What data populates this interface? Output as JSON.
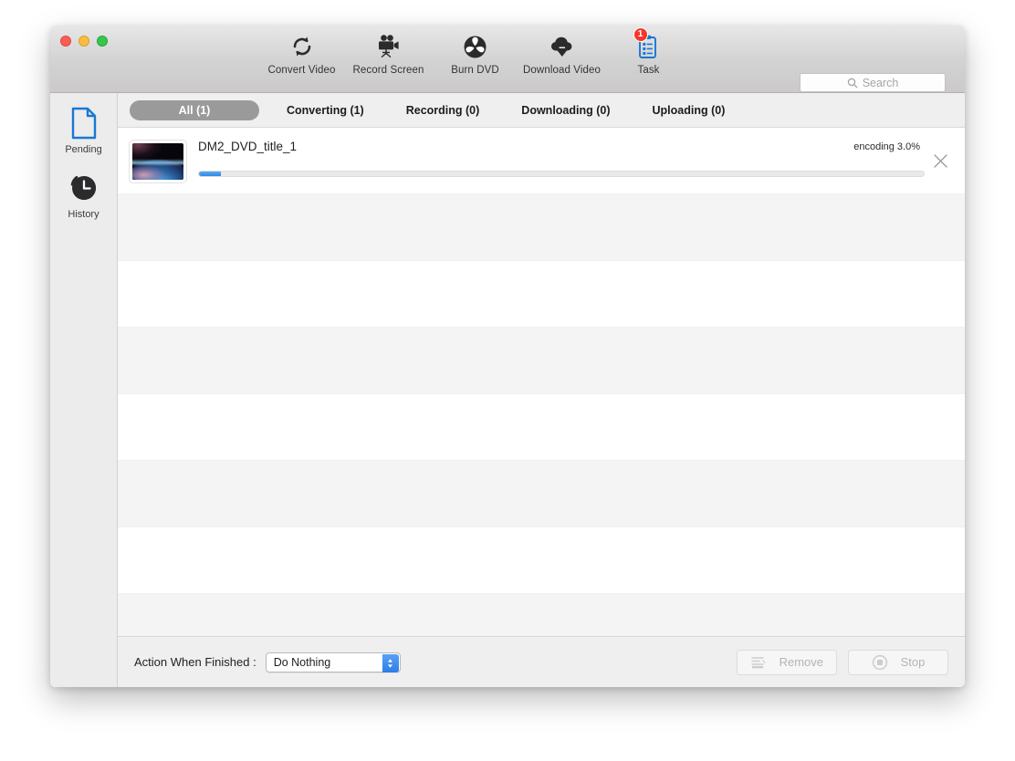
{
  "window": {
    "traffic_lights": [
      "close",
      "minimize",
      "maximize"
    ]
  },
  "toolbar": {
    "items": [
      {
        "label": "Convert Video",
        "icon": "convert-video-icon",
        "badge": null
      },
      {
        "label": "Record Screen",
        "icon": "record-screen-icon",
        "badge": null
      },
      {
        "label": "Burn DVD",
        "icon": "burn-dvd-icon",
        "badge": null
      },
      {
        "label": "Download Video",
        "icon": "download-video-icon",
        "badge": null
      },
      {
        "label": "Task",
        "icon": "task-icon",
        "badge": "1"
      }
    ],
    "search": {
      "placeholder": "Search",
      "value": "",
      "icon": "search-icon"
    }
  },
  "sidebar": {
    "items": [
      {
        "label": "Pending",
        "icon": "document-icon",
        "selected": true
      },
      {
        "label": "History",
        "icon": "history-clock-icon",
        "selected": false
      }
    ]
  },
  "tabs": [
    {
      "label": "All (1)",
      "active": true
    },
    {
      "label": "Converting (1)",
      "active": false
    },
    {
      "label": "Recording (0)",
      "active": false
    },
    {
      "label": "Downloading (0)",
      "active": false
    },
    {
      "label": "Uploading (0)",
      "active": false
    }
  ],
  "tasks": [
    {
      "title": "DM2_DVD_title_1",
      "status": "encoding 3.0%",
      "progress_percent": 3.0,
      "thumbnail": "earth-from-space-thumbnail",
      "close_icon": "close-icon"
    }
  ],
  "empty_row_count": 7,
  "bottom_bar": {
    "action_label": "Action When Finished :",
    "action_select": {
      "value": "Do Nothing",
      "options": [
        "Do Nothing"
      ],
      "stepper_icon": "stepper-updown-icon"
    },
    "remove_button": {
      "label": "Remove",
      "icon": "remove-list-icon",
      "enabled": false
    },
    "stop_button": {
      "label": "Stop",
      "icon": "stop-circle-icon",
      "enabled": false
    }
  },
  "colors": {
    "accent_blue": "#2f88e5",
    "badge_red": "#f8352b",
    "active_tab_gray": "#9a9a9a",
    "toolbar_gray": "#d3d3d3",
    "row_stripe": "#f4f4f4"
  }
}
